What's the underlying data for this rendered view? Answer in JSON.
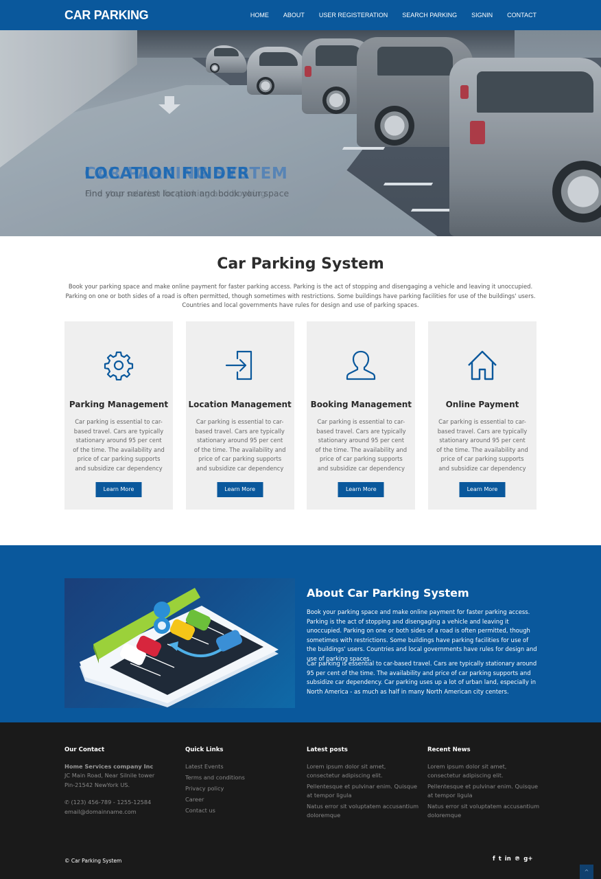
{
  "header": {
    "brand": "CAR PARKING",
    "nav": [
      "HOME",
      "ABOUT",
      "USER REGISTERATION",
      "SEARCH PARKING",
      "SIGNIN",
      "CONTACT"
    ]
  },
  "hero": {
    "slides": [
      {
        "title": "CAR PARKING SYSTEM",
        "subtitle": "One stop solution for parking and booking"
      },
      {
        "title": "LOCATION FINDER",
        "subtitle": "Find your nearest location and book your space"
      }
    ],
    "down_arrow_icon": "arrow-down-icon"
  },
  "intro": {
    "title": "Car Parking System",
    "text": "Book your parking space and make online payment for faster parking access. Parking is the act of stopping and disengaging a vehicle and leaving it unoccupied. Parking on one or both sides of a road is often permitted, though sometimes with restrictions. Some buildings have parking facilities for use of the buildings' users. Countries and local governments have rules for design and use of parking spaces.",
    "cards": [
      {
        "icon": "gear-icon",
        "title": "Parking Management",
        "text": "Car parking is essential to car-based travel. Cars are typically stationary around 95 per cent of the time. The availability and price of car parking supports and subsidize car dependency",
        "button": "Learn More"
      },
      {
        "icon": "sign-in-icon",
        "title": "Location Management",
        "text": "Car parking is essential to car-based travel. Cars are typically stationary around 95 per cent of the time. The availability and price of car parking supports and subsidize car dependency",
        "button": "Learn More"
      },
      {
        "icon": "user-icon",
        "title": "Booking Management",
        "text": "Car parking is essential to car-based travel. Cars are typically stationary around 95 per cent of the time. The availability and price of car parking supports and subsidize car dependency",
        "button": "Learn More"
      },
      {
        "icon": "home-icon",
        "title": "Online Payment",
        "text": "Car parking is essential to car-based travel. Cars are typically stationary around 95 per cent of the time. The availability and price of car parking supports and subsidize car dependency",
        "button": "Learn More"
      }
    ]
  },
  "about": {
    "title": "About Car Parking System",
    "p1": "Book your parking space and make online payment for faster parking access. Parking is the act of stopping and disengaging a vehicle and leaving it unoccupied. Parking on one or both sides of a road is often permitted, though sometimes with restrictions. Some buildings have parking facilities for use of the buildings' users. Countries and local governments have rules for design and use of parking spaces.",
    "p2": "Car parking is essential to car-based travel. Cars are typically stationary around 95 per cent of the time. The availability and price of car parking supports and subsidize car dependency. Car parking uses up a lot of urban land, especially in North America - as much as half in many North American city centers.",
    "image_alt": "parking-lot-illustration"
  },
  "footer": {
    "contact": {
      "heading": "Our Contact",
      "company": "Home Services company Inc",
      "address1": "JC Main Road, Near Silnile tower",
      "address2": "Pin-21542 NewYork US.",
      "phone": "(123) 456-789 - 1255-12584",
      "email": "email@domainname.com"
    },
    "quick_links": {
      "heading": "Quick Links",
      "items": [
        "Latest Events",
        "Terms and conditions",
        "Privacy policy",
        "Career",
        "Contact us"
      ]
    },
    "latest_posts": {
      "heading": "Latest posts",
      "items": [
        "Lorem ipsum dolor sit amet, consectetur adipiscing elit.",
        "Pellentesque et pulvinar enim. Quisque at tempor ligula",
        "Natus error sit voluptatem accusantium doloremque"
      ]
    },
    "recent_news": {
      "heading": "Recent News",
      "items": [
        "Lorem ipsum dolor sit amet, consectetur adipiscing elit.",
        "Pellentesque et pulvinar enim. Quisque at tempor ligula",
        "Natus error sit voluptatem accusantium doloremque"
      ]
    },
    "copyright": "© Car Parking System",
    "social": [
      {
        "name": "facebook-icon",
        "glyph": "f"
      },
      {
        "name": "twitter-icon",
        "glyph": "t"
      },
      {
        "name": "linkedin-icon",
        "glyph": "in"
      },
      {
        "name": "pinterest-icon",
        "glyph": "℗"
      },
      {
        "name": "google-plus-icon",
        "glyph": "g+"
      }
    ],
    "to_top": "^"
  },
  "colors": {
    "primary": "#0a589c",
    "card_bg": "#efefef",
    "footer_bg": "#1a1a1a"
  }
}
